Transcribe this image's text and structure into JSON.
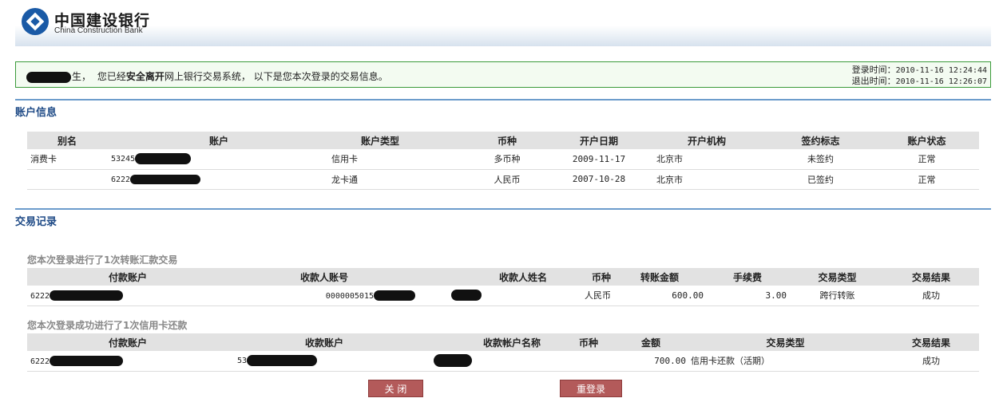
{
  "header": {
    "bank_name_cn": "中国建设银行",
    "bank_name_en": "China Construction Bank"
  },
  "status": {
    "msg_suffix": "生，",
    "msg_before_bold": "您已经",
    "msg_bold": "安全离开",
    "msg_after_bold": "网上银行交易系统， 以下是您本次登录的交易信息。",
    "login_label": "登录时间：",
    "login_time": "2010-11-16 12:24:44",
    "logout_label": "退出时间：",
    "logout_time": "2010-11-16 12:26:07"
  },
  "accounts": {
    "title": "账户信息",
    "headers": [
      "别名",
      "账户",
      "账户类型",
      "币种",
      "开户日期",
      "开户机构",
      "签约标志",
      "账户状态"
    ],
    "rows": [
      {
        "alias": "消费卡",
        "account": "53245",
        "type": "信用卡",
        "currency": "多币种",
        "date": "2009-11-17",
        "branch": "北京市",
        "sign": "未签约",
        "state": "正常"
      },
      {
        "alias": "",
        "account": "6222",
        "type": "龙卡通",
        "currency": "人民币",
        "date": "2007-10-28",
        "branch": "北京市",
        "sign": "已签约",
        "state": "正常"
      }
    ]
  },
  "records": {
    "title": "交易记录",
    "transfer": {
      "subtitle": "您本次登录进行了1次转账汇款交易",
      "headers": [
        "付款账户",
        "收款人账号",
        "收款人姓名",
        "币种",
        "转账金额",
        "手续费",
        "交易类型",
        "交易结果"
      ],
      "rows": [
        {
          "payer": "6222",
          "payee_acct": "0000005015",
          "payee_name": "",
          "currency": "人民币",
          "amount": "600.00",
          "fee": "3.00",
          "type": "跨行转账",
          "result": "成功"
        }
      ]
    },
    "repay": {
      "subtitle": "您本次登录成功进行了1次信用卡还款",
      "headers": [
        "付款账户",
        "收款账户",
        "收款帐户名称",
        "币种",
        "金额",
        "交易类型",
        "交易结果"
      ],
      "rows": [
        {
          "payer": "6222",
          "payee_acct": "53",
          "payee_name": "",
          "currency": "",
          "amount": "700.00",
          "type": "信用卡还款（活期）",
          "result": "成功"
        }
      ]
    }
  },
  "buttons": {
    "close": "关 闭",
    "relogin": "重登录"
  }
}
